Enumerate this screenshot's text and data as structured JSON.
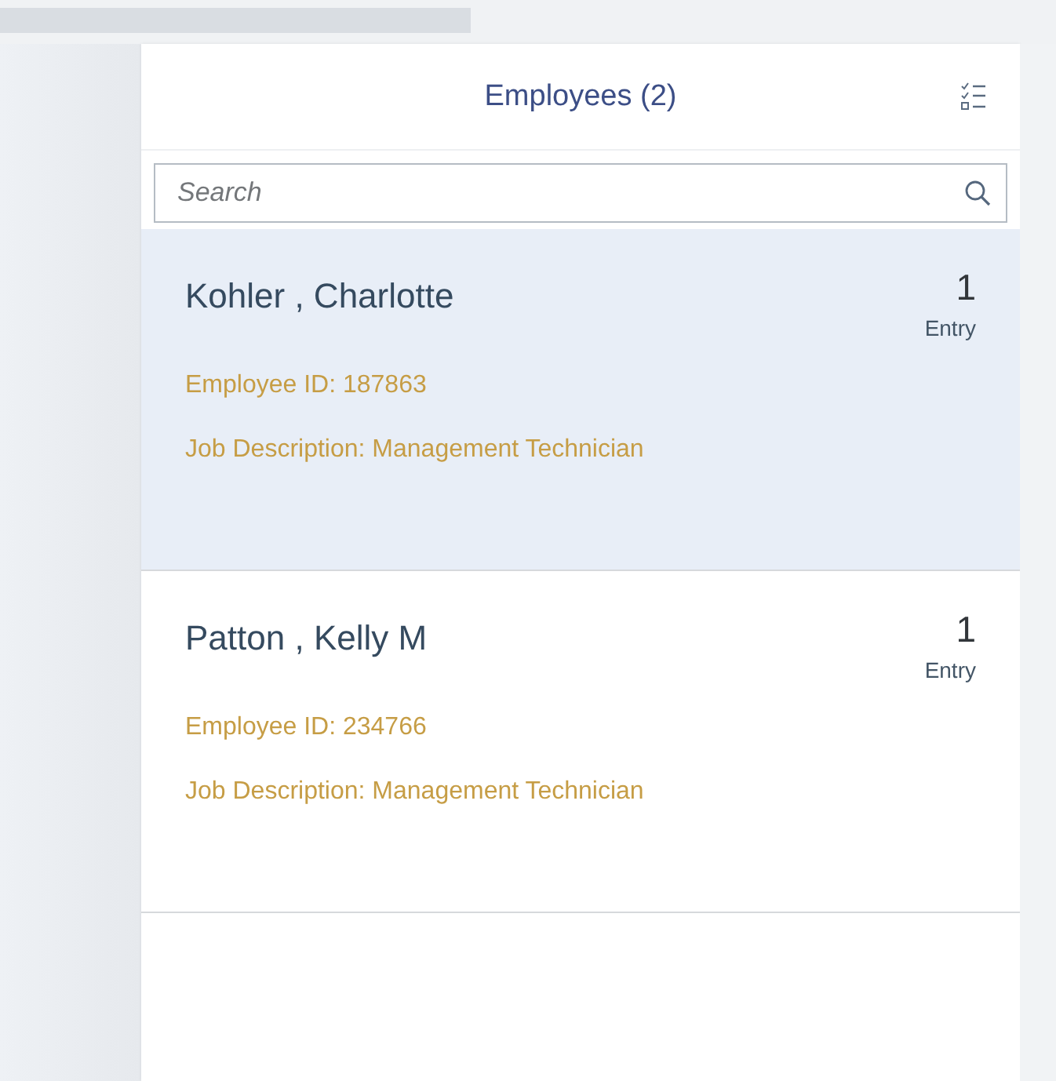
{
  "header": {
    "title": "Employees (2)"
  },
  "search": {
    "placeholder": "Search"
  },
  "employees": [
    {
      "name": "Kohler , Charlotte",
      "count": "1",
      "count_label": "Entry",
      "employee_id": "Employee ID: 187863",
      "job": "Job Description: Management Technician",
      "selected": true
    },
    {
      "name": "Patton , Kelly M",
      "count": "1",
      "count_label": "Entry",
      "employee_id": "Employee ID: 234766",
      "job": "Job Description: Management Technician",
      "selected": false
    }
  ]
}
